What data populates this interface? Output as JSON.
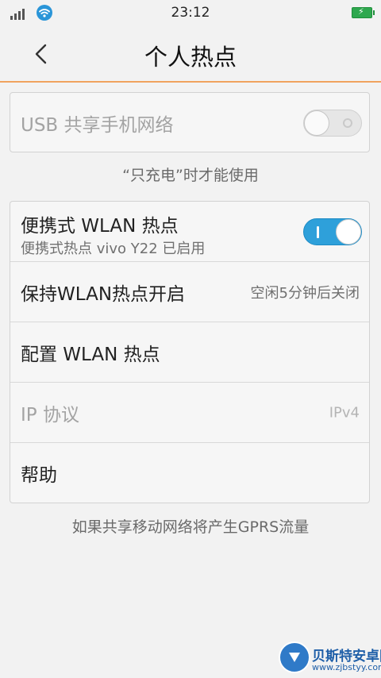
{
  "status_bar": {
    "time": "23:12",
    "signal_icon": "signal-bars-icon",
    "wifi_icon": "wifi-icon",
    "battery_icon": "battery-charging-icon"
  },
  "header": {
    "title": "个人热点",
    "back_icon": "back-chevron-icon"
  },
  "usb_section": {
    "label": "USB 共享手机网络",
    "toggle_on": false,
    "disabled": true,
    "note": "“只充电”时才能使用"
  },
  "wlan_section": {
    "hotspot": {
      "label": "便携式 WLAN 热点",
      "sublabel": "便携式热点 vivo Y22 已启用",
      "toggle_on": true
    },
    "keep_on": {
      "label": "保持WLAN热点开启",
      "value": "空闲5分钟后关闭"
    },
    "configure": {
      "label": "配置 WLAN 热点"
    },
    "ip_protocol": {
      "label": "IP 协议",
      "value": "IPv4",
      "disabled": true
    },
    "help": {
      "label": "帮助"
    }
  },
  "footer_note": "如果共享移动网络将产生GPRS流量",
  "watermark": {
    "title": "贝斯特安卓网",
    "url": "www.zjbstyy.com"
  },
  "colors": {
    "accent_line": "#f0a35e",
    "toggle_on": "#2ea0da",
    "background": "#f2f2f2"
  }
}
